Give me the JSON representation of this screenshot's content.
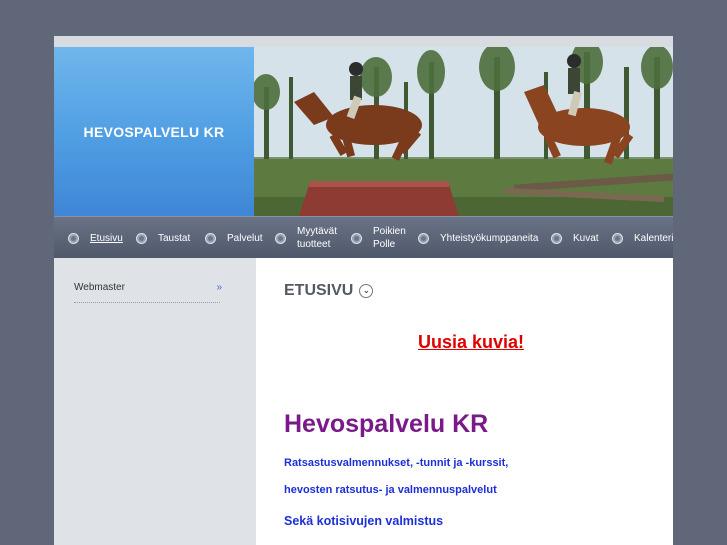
{
  "site": {
    "logo_text": "HEVOSPALVELU KR"
  },
  "nav": {
    "items": [
      {
        "label": "Etusivu",
        "current": true
      },
      {
        "label": "Taustat"
      },
      {
        "label": "Palvelut"
      },
      {
        "label": "Myytävät tuotteet"
      },
      {
        "label": "Poikien Polle"
      },
      {
        "label": "Yhteistyökumppaneita"
      },
      {
        "label": "Kuvat"
      },
      {
        "label": "Kalenteri"
      }
    ]
  },
  "sidebar": {
    "items": [
      {
        "label": "Webmaster",
        "arrow": "»"
      }
    ]
  },
  "content": {
    "heading": "ETUSIVU",
    "new_pictures_link": "Uusia kuvia!",
    "main_title": "Hevospalvelu KR",
    "line1": "Ratsastusvalmennukset, -tunnit ja -kurssit,",
    "line2": "hevosten ratsutus- ja valmennuspalvelut",
    "line3": "Sekä kotisivujen valmistus"
  },
  "colors": {
    "background": "#5f6778",
    "logo_blue": "#4f9de3",
    "nav_bg": "#4f586b",
    "link_red": "#e00000",
    "title_purple": "#7a1a8a",
    "text_blue": "#1c2fd8"
  }
}
